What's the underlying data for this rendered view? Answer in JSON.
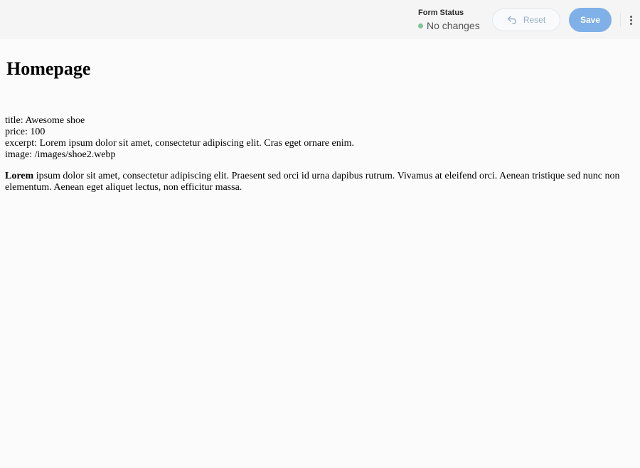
{
  "toolbar": {
    "status_title": "Form Status",
    "status_text": "No changes",
    "status_color": "#7fc59a",
    "reset_label": "Reset",
    "reset_icon": "undo-icon",
    "save_label": "Save",
    "save_color": "#7fb0e8",
    "more_icon": "more-vertical-icon"
  },
  "page": {
    "title": "Homepage",
    "fields": [
      "title: Awesome shoe",
      "price: 100",
      "excerpt: Lorem ipsum dolor sit amet, consectetur adipiscing elit. Cras eget ornare enim.",
      "image: /images/shoe2.webp"
    ],
    "body_bold": "Lorem",
    "body_rest": " ipsum dolor sit amet, consectetur adipiscing elit. Praesent sed orci id urna dapibus rutrum. Vivamus at eleifend orci. Aenean tristique sed nunc non elementum. Aenean eget aliquet lectus, non efficitur massa."
  }
}
